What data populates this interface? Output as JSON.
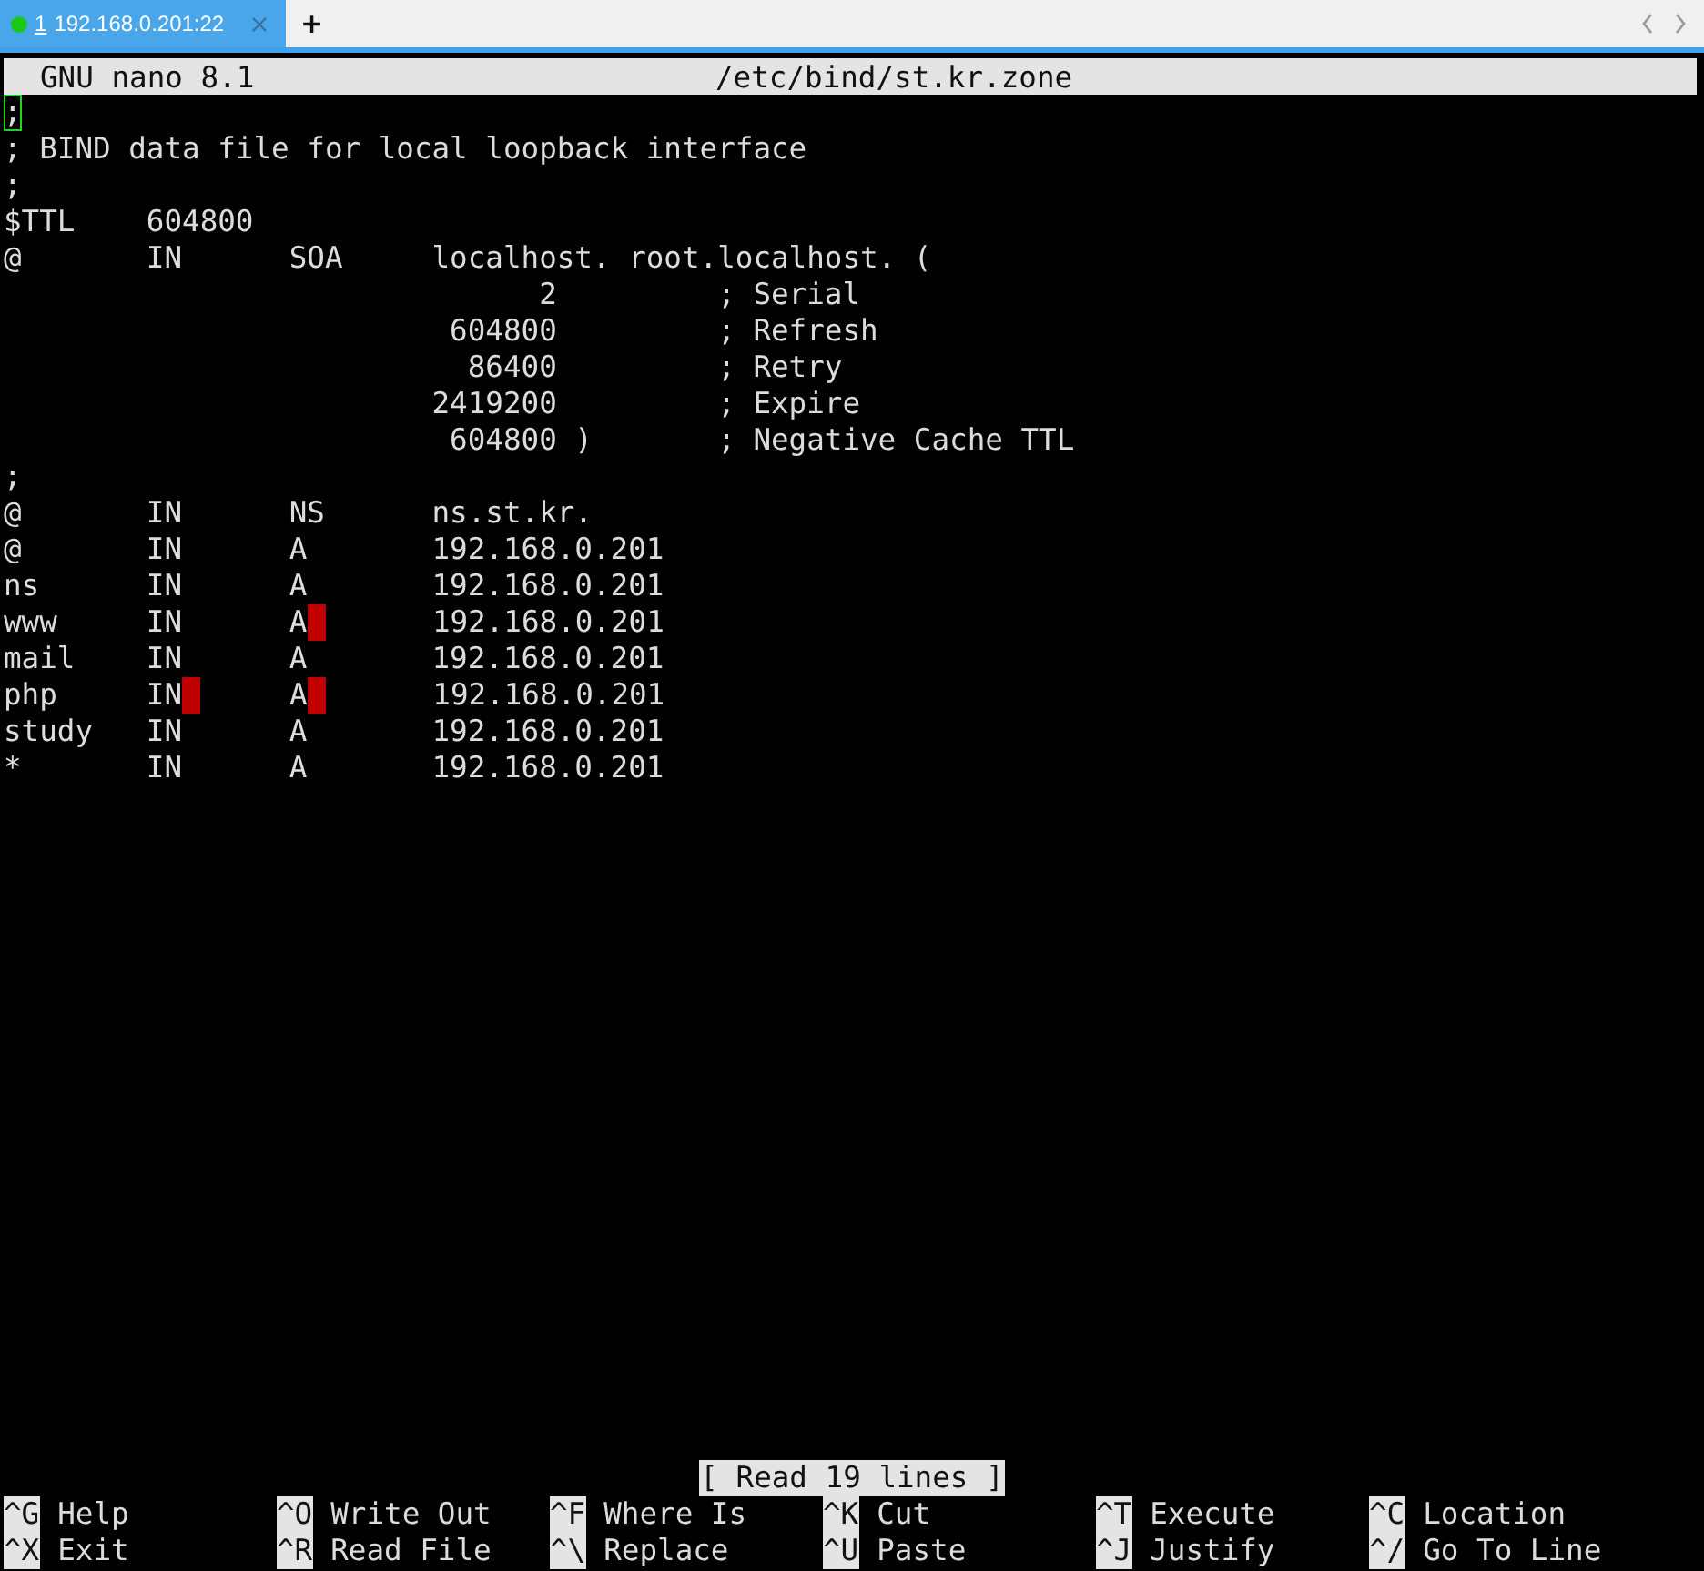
{
  "tabs": [
    {
      "number": "1",
      "label": "192.168.0.201:22",
      "selected": true,
      "connected": true
    }
  ],
  "new_tab_button": "+",
  "editor": {
    "app": "GNU nano 8.1",
    "file": "/etc/bind/st.kr.zone",
    "lines": [
      {
        "parts": [
          {
            "kind": "cursor",
            "text": ";"
          }
        ]
      },
      {
        "parts": [
          {
            "kind": "text",
            "text": "; BIND data file for local loopback interface"
          }
        ]
      },
      {
        "parts": [
          {
            "kind": "text",
            "text": ";"
          }
        ]
      },
      {
        "parts": [
          {
            "kind": "text",
            "text": "$TTL    604800"
          }
        ]
      },
      {
        "parts": [
          {
            "kind": "text",
            "text": "@       IN      SOA     localhost. root.localhost. ("
          }
        ]
      },
      {
        "parts": [
          {
            "kind": "text",
            "text": "                              2         ; Serial"
          }
        ]
      },
      {
        "parts": [
          {
            "kind": "text",
            "text": "                         604800         ; Refresh"
          }
        ]
      },
      {
        "parts": [
          {
            "kind": "text",
            "text": "                          86400         ; Retry"
          }
        ]
      },
      {
        "parts": [
          {
            "kind": "text",
            "text": "                        2419200         ; Expire"
          }
        ]
      },
      {
        "parts": [
          {
            "kind": "text",
            "text": "                         604800 )       ; Negative Cache TTL"
          }
        ]
      },
      {
        "parts": [
          {
            "kind": "text",
            "text": ";"
          }
        ]
      },
      {
        "parts": [
          {
            "kind": "text",
            "text": "@       IN      NS      ns.st.kr."
          }
        ]
      },
      {
        "parts": [
          {
            "kind": "text",
            "text": "@       IN      A       192.168.0.201"
          }
        ]
      },
      {
        "parts": [
          {
            "kind": "text",
            "text": "ns      IN      A       192.168.0.201"
          }
        ]
      },
      {
        "parts": [
          {
            "kind": "text",
            "text": "www     IN      A"
          },
          {
            "kind": "marker"
          },
          {
            "kind": "text",
            "text": "      192.168.0.201"
          }
        ]
      },
      {
        "parts": [
          {
            "kind": "text",
            "text": "mail    IN      A       192.168.0.201"
          }
        ]
      },
      {
        "parts": [
          {
            "kind": "text",
            "text": "php     IN"
          },
          {
            "kind": "marker"
          },
          {
            "kind": "text",
            "text": "     A"
          },
          {
            "kind": "marker"
          },
          {
            "kind": "text",
            "text": "      192.168.0.201"
          }
        ]
      },
      {
        "parts": [
          {
            "kind": "text",
            "text": "study   IN      A       192.168.0.201"
          }
        ]
      },
      {
        "parts": [
          {
            "kind": "text",
            "text": "*       IN      A       192.168.0.201"
          }
        ]
      }
    ],
    "status": "[ Read 19 lines ]",
    "shortcuts": [
      {
        "key": "^G",
        "label": "Help"
      },
      {
        "key": "^O",
        "label": "Write Out"
      },
      {
        "key": "^F",
        "label": "Where Is"
      },
      {
        "key": "^K",
        "label": "Cut"
      },
      {
        "key": "^T",
        "label": "Execute"
      },
      {
        "key": "^C",
        "label": "Location"
      },
      {
        "key": "^X",
        "label": "Exit"
      },
      {
        "key": "^R",
        "label": "Read File"
      },
      {
        "key": "^\\",
        "label": "Replace"
      },
      {
        "key": "^U",
        "label": "Paste"
      },
      {
        "key": "^J",
        "label": "Justify"
      },
      {
        "key": "^/",
        "label": "Go To Line"
      }
    ]
  }
}
